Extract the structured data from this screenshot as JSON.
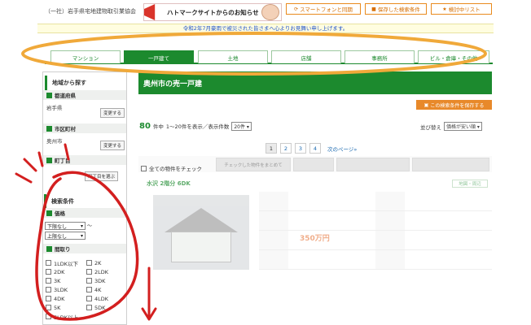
{
  "header": {
    "association": "（一社）岩手県宅地建物取引業協会",
    "banner_text": "ハトマークサイトからのお知らせ",
    "buttons": [
      {
        "label": "スマートフォンと同期"
      },
      {
        "label": "保存した検索条件"
      },
      {
        "label": "検討中リスト"
      }
    ]
  },
  "notice": "令和2年7月豪雨で被災された皆さまへ心よりお見舞い申し上げます。",
  "tabs": [
    {
      "label": "マンション",
      "active": false
    },
    {
      "label": "一戸建て",
      "active": true
    },
    {
      "label": "土地",
      "active": false
    },
    {
      "label": "店舗",
      "active": false
    },
    {
      "label": "事務所",
      "active": false
    },
    {
      "label": "ビル・倉庫・その他",
      "active": false
    }
  ],
  "sidebar": {
    "area_heading": "地域から探す",
    "prefecture": {
      "label": "都道府県",
      "value": "岩手県",
      "change_label": "変更する"
    },
    "city": {
      "label": "市区町村",
      "value": "奥州市",
      "change_label": "変更する"
    },
    "town": {
      "label": "町丁目",
      "button_label": "町丁目を選ぶ"
    },
    "conditions_heading": "検索条件",
    "price": {
      "label": "価格",
      "min_value": "下限なし",
      "max_value": "上限なし",
      "range_sep": "〜"
    },
    "layout": {
      "label": "間取り",
      "options_left": [
        "1LDK以下",
        "2DK",
        "3K",
        "3LDK",
        "4DK",
        "5K",
        "5LDK以上"
      ],
      "options_right": [
        "2K",
        "2LDK",
        "3DK",
        "4K",
        "4LDK",
        "5DK"
      ]
    }
  },
  "main": {
    "title": "奥州市の売一戸建",
    "save_button": "この検索条件を保存する",
    "result_count": "80",
    "result_unit": "件中",
    "result_range": "1〜20件を表示／表示件数",
    "per_page_value": "20件",
    "sort_label": "並び替え",
    "sort_value": "価格が安い順",
    "pages": [
      "1",
      "2",
      "3",
      "4"
    ],
    "next_label": "次のページ»",
    "check_all_label": "全ての物件をチェック",
    "checked_note": "チェックした物件をまとめて",
    "bulk_buttons": [
      "",
      "",
      ""
    ],
    "listing": {
      "title": "水沢 2階分 6DK",
      "price": "350万円",
      "map_label": "地図・周辺"
    }
  },
  "colors": {
    "brand_green": "#1c8a2e",
    "accent_orange": "#e8892a",
    "annotation_red": "#d31f1f",
    "annotation_orange_outline": "#f0a93a"
  }
}
